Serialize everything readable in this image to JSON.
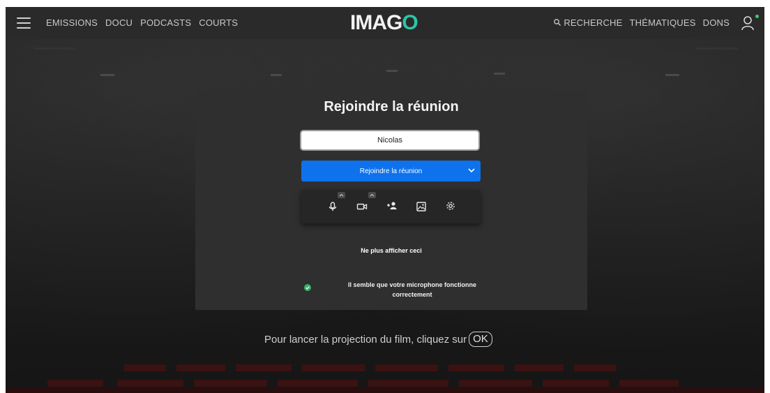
{
  "nav": {
    "links_left": [
      "EMISSIONS",
      "DOCU",
      "PODCASTS",
      "COURTS"
    ],
    "logo": {
      "part1": "IMA",
      "part2": "G",
      "part3": "O"
    },
    "search_label": "RECHERCHE",
    "links_right": [
      "THÉMATIQUES",
      "DONS"
    ]
  },
  "modal": {
    "title": "Rejoindre la réunion",
    "name_value": "Nicolas",
    "join_label": "Rejoindre la réunion",
    "dont_show": "Ne plus afficher ceci",
    "mic_status_line1": "Il semble que votre microphone fonctionne",
    "mic_status_line2": "correctement"
  },
  "prompt": {
    "text": "Pour lancer la projection du film, cliquez sur",
    "ok_label": "OK"
  },
  "colors": {
    "accent_blue": "#0e72ed",
    "logo_accent": "#2ec4a6",
    "status_green": "#3ccf6b"
  },
  "icons": [
    "menu-icon",
    "search-icon",
    "user-icon",
    "microphone-icon",
    "camera-icon",
    "invite-user-icon",
    "background-image-icon",
    "settings-gear-icon",
    "chevron-down-icon",
    "check-circle-icon"
  ]
}
